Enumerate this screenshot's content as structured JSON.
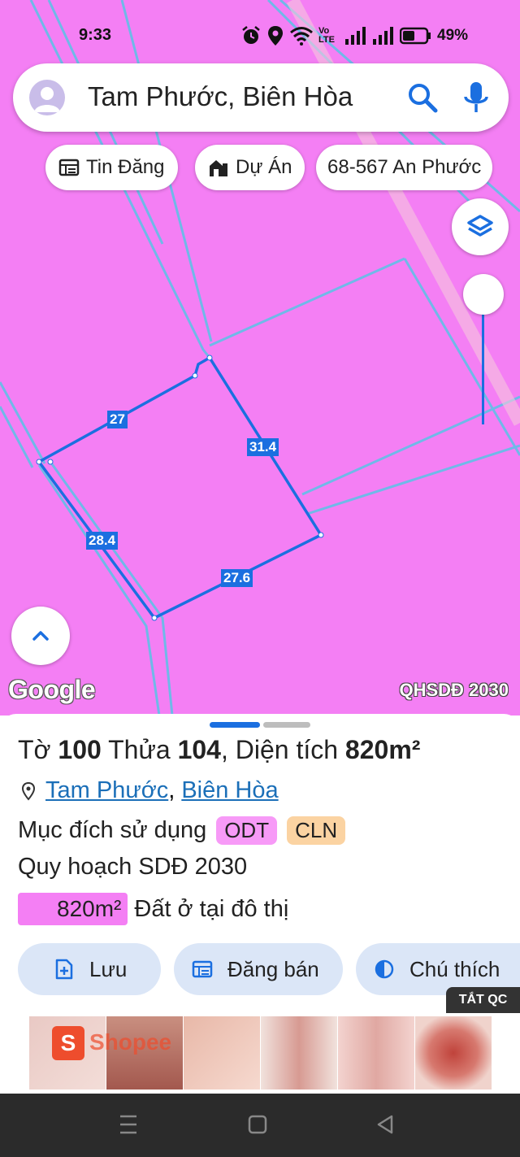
{
  "status_bar": {
    "time": "9:33",
    "network_label": "Vo LTE",
    "battery": "49%"
  },
  "search": {
    "query": "Tam Phước, Biên Hòa"
  },
  "chips": [
    {
      "label": "Tin Đăng",
      "icon": "listing-icon"
    },
    {
      "label": "Dự Án",
      "icon": "project-building-icon"
    },
    {
      "label": "68-567 An Phước",
      "icon": ""
    }
  ],
  "map": {
    "background_color": "#f47ff4",
    "parcel_edge_color": "#1b6fe0",
    "edges": [
      "27",
      "31.4",
      "28.4",
      "27.6"
    ],
    "logo": "Google",
    "layer_badge": "QHSDĐ 2030"
  },
  "parcel": {
    "title_prefix": "Tờ",
    "sheet_no": "100",
    "plot_label": "Thửa",
    "plot_no": "104",
    "area_label": ", Diện tích",
    "area": "820m²",
    "location_ward": "Tam Phước",
    "location_sep": ",",
    "location_city": "Biên Hòa",
    "purpose_label": "Mục đích sử dụng",
    "purpose_tags": [
      "ODT",
      "CLN"
    ],
    "plan_label": "Quy hoạch SDĐ 2030",
    "plan_area": "820m²",
    "plan_desc": "Đất ở tại đô thị"
  },
  "actions": {
    "save": "Lưu",
    "post_sale": "Đăng bán",
    "legend": "Chú thích"
  },
  "ad": {
    "close_label": "TẮT QC",
    "brand": "Shopee",
    "brand_letter": "S"
  }
}
